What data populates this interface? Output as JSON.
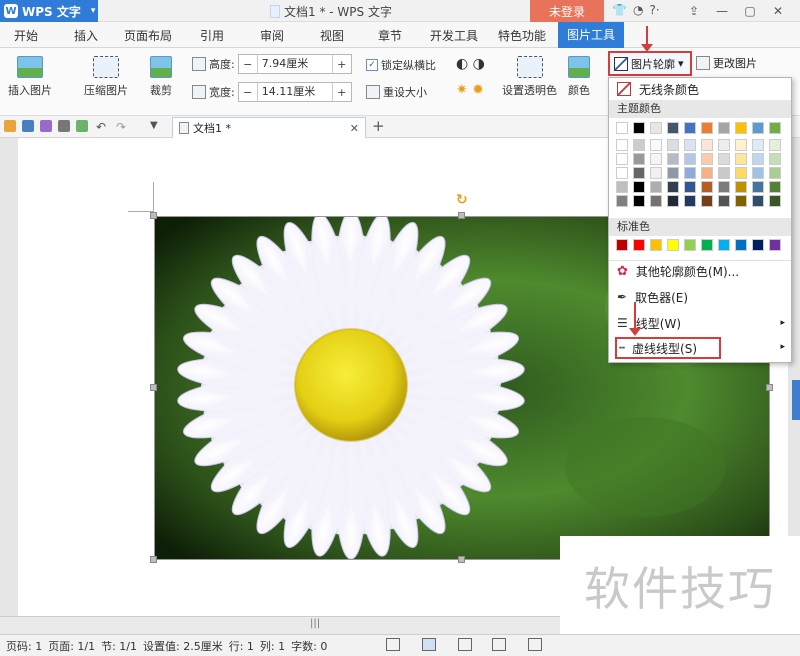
{
  "titlebar": {
    "app_name": "WPS 文字",
    "doc_title": "文档1 * - WPS 文字",
    "login_label": "未登录"
  },
  "tabs": [
    "开始",
    "插入",
    "页面布局",
    "引用",
    "审阅",
    "视图",
    "章节",
    "开发工具",
    "特色功能",
    "图片工具"
  ],
  "active_tab": "图片工具",
  "ribbon": {
    "insert_picture": "插入图片",
    "compress_picture": "压缩图片",
    "crop": "裁剪",
    "height_label": "高度:",
    "height_value": "7.94厘米",
    "width_label": "宽度:",
    "width_value": "14.11厘米",
    "lock_ratio": "锁定纵横比",
    "reset_size": "重设大小",
    "set_transparent": "设置透明色",
    "color": "颜色",
    "picture_outline": "图片轮廓",
    "change_picture": "更改图片"
  },
  "doc_tab": {
    "name": "文档1 *"
  },
  "dropdown": {
    "no_line_color": "无线条颜色",
    "theme_colors_header": "主题颜色",
    "standard_colors_header": "标准色",
    "more_colors": "其他轮廓颜色(M)...",
    "eyedropper": "取色器(E)",
    "line_type": "线型(W)",
    "dash_type": "虚线线型(S)",
    "theme_colors": [
      "#ffffff",
      "#000000",
      "#e7e6e6",
      "#44546a",
      "#4472c4",
      "#ed7d31",
      "#a5a5a5",
      "#ffc000",
      "#5b9bd5",
      "#70ad47"
    ],
    "standard_colors": [
      "#c00000",
      "#ff0000",
      "#ffc000",
      "#ffff00",
      "#92d050",
      "#00b050",
      "#00b0f0",
      "#0070c0",
      "#002060",
      "#7030a0"
    ]
  },
  "statusbar": {
    "page_no": "页码: 1",
    "pages": "页面: 1/1",
    "section": "节: 1/1",
    "setting": "设置值: 2.5厘米",
    "row": "行: 1",
    "col": "列: 1",
    "words": "字数: 0"
  },
  "watermark": "软件技巧",
  "colors": {
    "accent": "#2e7dd6",
    "login": "#e8735a",
    "highlight": "#d23d3d"
  }
}
